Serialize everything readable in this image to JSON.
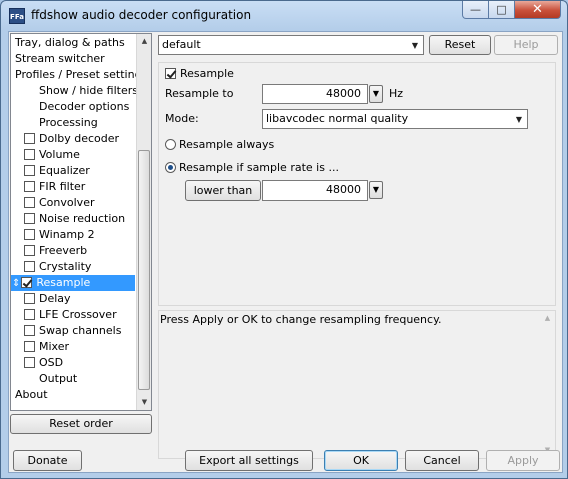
{
  "window": {
    "title": "ffdshow audio decoder configuration",
    "app_icon_text": "FFa",
    "minimize_glyph": "—",
    "maximize_glyph": "□",
    "close_glyph": "✕"
  },
  "tree": {
    "items": [
      {
        "label": "Tray, dialog & paths"
      },
      {
        "label": "Stream switcher"
      },
      {
        "label": "Profiles / Preset settings"
      },
      {
        "label": "Show / hide filters"
      },
      {
        "label": "Decoder options"
      },
      {
        "label": "Processing"
      },
      {
        "label": "Dolby decoder",
        "checked": false
      },
      {
        "label": "Volume",
        "checked": false
      },
      {
        "label": "Equalizer",
        "checked": false
      },
      {
        "label": "FIR filter",
        "checked": false
      },
      {
        "label": "Convolver",
        "checked": false
      },
      {
        "label": "Noise reduction",
        "checked": false
      },
      {
        "label": "Winamp 2",
        "checked": false
      },
      {
        "label": "Freeverb",
        "checked": false
      },
      {
        "label": "Crystality",
        "checked": false
      },
      {
        "label": "Resample",
        "checked": true,
        "selected": true
      },
      {
        "label": "Delay",
        "checked": false
      },
      {
        "label": "LFE Crossover",
        "checked": false
      },
      {
        "label": "Swap channels",
        "checked": false
      },
      {
        "label": "Mixer",
        "checked": false
      },
      {
        "label": "OSD",
        "checked": false
      },
      {
        "label": "Output"
      },
      {
        "label": "About"
      }
    ],
    "reset_order_label": "Reset order"
  },
  "preset": {
    "value": "default",
    "reset_label": "Reset",
    "help_label": "Help"
  },
  "resample": {
    "enable_label": "Resample",
    "enabled": true,
    "resample_to_label": "Resample to",
    "resample_to_value": "48000",
    "unit": "Hz",
    "mode_label": "Mode:",
    "mode_value": "libavcodec normal quality",
    "always_label": "Resample always",
    "if_label": "Resample if sample rate is ...",
    "condition_label": "lower than",
    "condition_value": "48000"
  },
  "info_text": "Press Apply or OK to change resampling frequency.",
  "footer": {
    "donate_label": "Donate",
    "export_label": "Export all settings",
    "ok_label": "OK",
    "cancel_label": "Cancel",
    "apply_label": "Apply"
  }
}
